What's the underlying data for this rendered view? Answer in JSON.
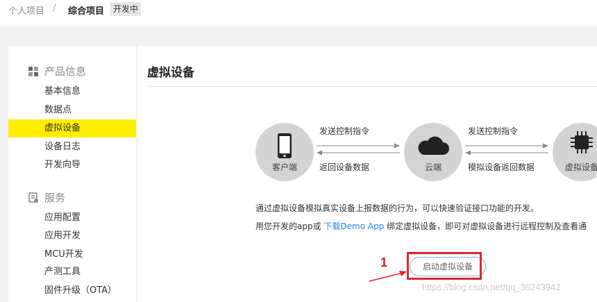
{
  "breadcrumb": {
    "root": "个人项目",
    "separator": "/",
    "current": "综合项目",
    "status_badge": "开发中"
  },
  "sidebar": {
    "sections": [
      {
        "title": "产品信息",
        "icon": "grid-icon",
        "items": [
          "基本信息",
          "数据点",
          "虚拟设备",
          "设备日志",
          "开发向导"
        ]
      },
      {
        "title": "服务",
        "icon": "service-icon",
        "items": [
          "应用配置",
          "应用开发",
          "MCU开发",
          "产测工具",
          "固件升级（OTA）"
        ]
      }
    ],
    "active_item": "虚拟设备",
    "active_color": "#ffee00"
  },
  "main": {
    "title": "虚拟设备",
    "diagram": {
      "nodes": [
        {
          "label": "客户端",
          "icon": "phone-icon"
        },
        {
          "label": "云端",
          "icon": "cloud-icon"
        },
        {
          "label": "虚拟设备",
          "icon": "chip-icon"
        }
      ],
      "links": [
        {
          "top": "发送控制指令",
          "bottom": "返回设备数据"
        },
        {
          "top": "发送控制指令",
          "bottom": "模拟设备返回数据"
        }
      ]
    },
    "description_line1": "通过虚拟设备模拟真实设备上报数据的行为，可以快速验证接口功能的开发。",
    "description_line2_prefix": "用您开发的app或",
    "description_link": "下载Demo App",
    "description_line2_suffix": "绑定虚拟设备，即可对虚拟设备进行远程控制及查看通",
    "start_button": "启动虚拟设备",
    "annotation_number": "1",
    "link_color": "#1e88e5",
    "annotation_color": "#e0242b"
  },
  "watermark": "https://blog.csdn.net/qq_36243942"
}
